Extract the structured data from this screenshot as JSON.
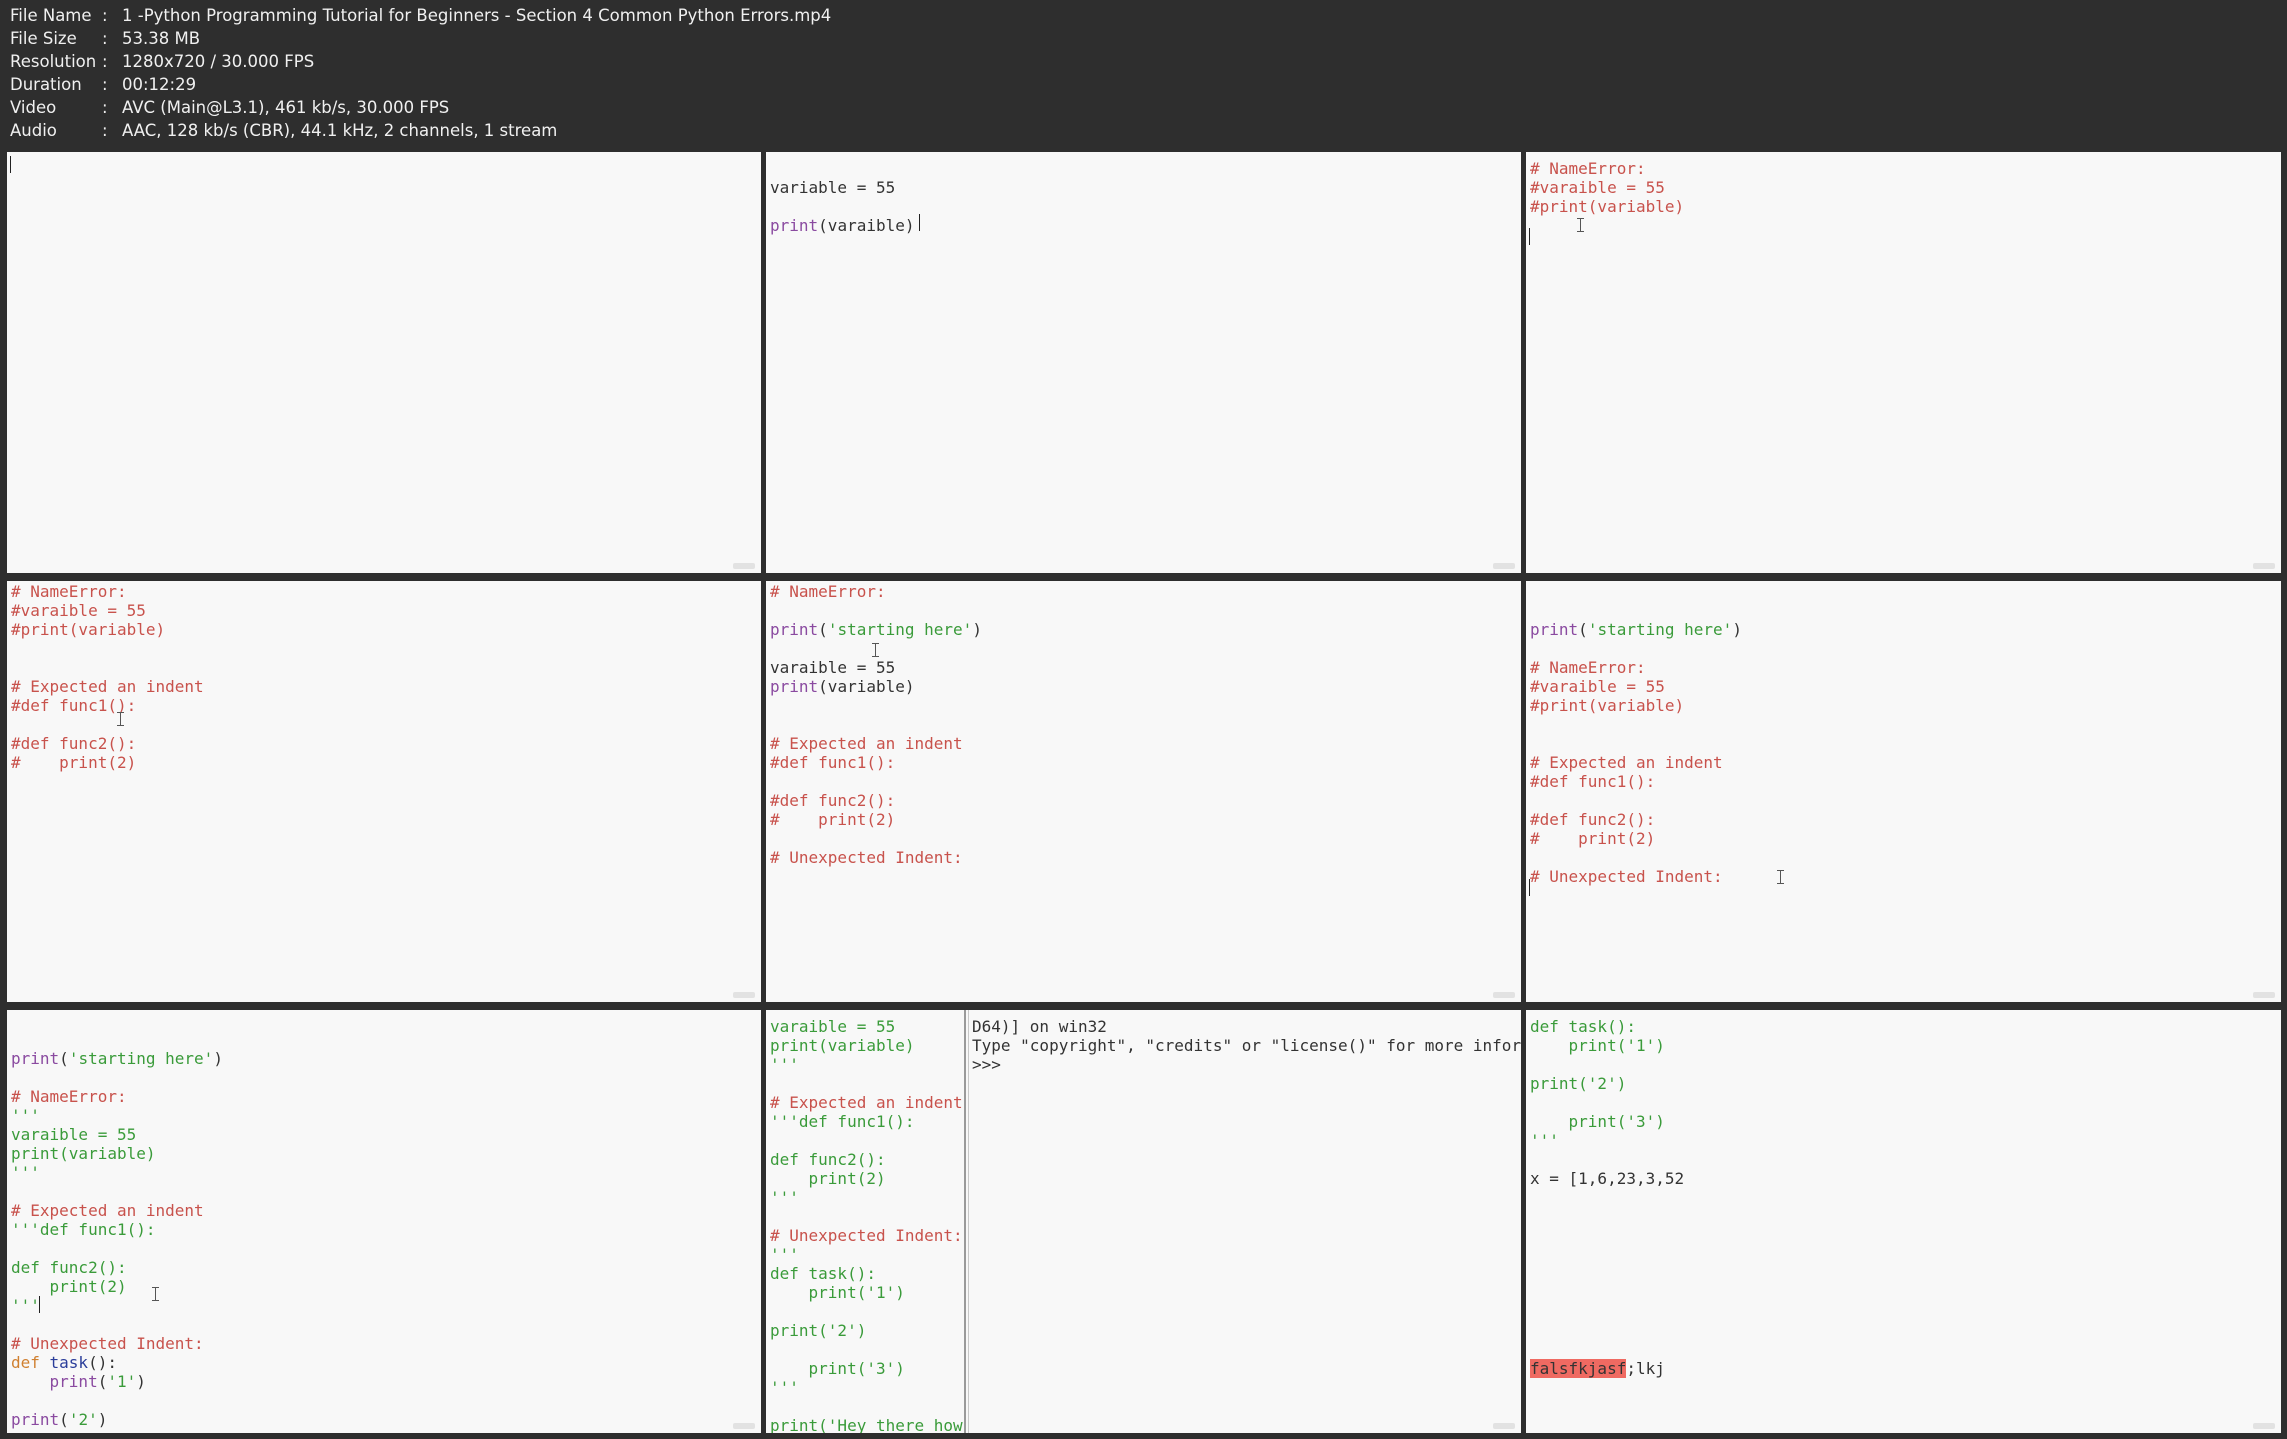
{
  "file_info": [
    {
      "key": "File Name",
      "value": "1 -Python Programming Tutorial for Beginners - Section 4 Common Python Errors.mp4"
    },
    {
      "key": "File Size",
      "value": "53.38 MB"
    },
    {
      "key": "Resolution",
      "value": "1280x720 / 30.000 FPS"
    },
    {
      "key": "Duration",
      "value": "00:12:29"
    },
    {
      "key": "Video",
      "value": "AVC (Main@L3.1), 461 kb/s, 30.000 FPS"
    },
    {
      "key": "Audio",
      "value": "AAC, 128 kb/s (CBR), 44.1 kHz, 2 channels, 1 stream"
    }
  ],
  "separator": ":",
  "colors": {
    "comment": "#c8524c",
    "string": "#3a9b3a",
    "builtin": "#8a4aa0",
    "keyword": "#d08030",
    "def": "#2b3e9a",
    "error_highlight": "#ef6a62"
  },
  "thumbnails": [
    {
      "lines": []
    },
    {
      "lines": [
        [],
        [
          {
            "t": "variable = 55",
            "c": "plain"
          }
        ],
        [],
        [
          {
            "t": "print",
            "c": "builtin"
          },
          {
            "t": "(varaible)",
            "c": "plain"
          }
        ]
      ]
    },
    {
      "lines": [
        [
          {
            "t": "# NameError:",
            "c": "comment"
          }
        ],
        [
          {
            "t": "#varaible = 55",
            "c": "comment"
          }
        ],
        [
          {
            "t": "#print(variable)",
            "c": "comment"
          }
        ]
      ]
    },
    {
      "lines": [
        [
          {
            "t": "# NameError:",
            "c": "comment"
          }
        ],
        [
          {
            "t": "#varaible = 55",
            "c": "comment"
          }
        ],
        [
          {
            "t": "#print(variable)",
            "c": "comment"
          }
        ],
        [],
        [],
        [
          {
            "t": "# Expected an indent",
            "c": "comment"
          }
        ],
        [
          {
            "t": "#def func1():",
            "c": "comment"
          }
        ],
        [],
        [
          {
            "t": "#def func2():",
            "c": "comment"
          }
        ],
        [
          {
            "t": "#    print(2)",
            "c": "comment"
          }
        ]
      ]
    },
    {
      "lines": [
        [
          {
            "t": "# NameError:",
            "c": "comment"
          }
        ],
        [],
        [
          {
            "t": "print",
            "c": "builtin"
          },
          {
            "t": "(",
            "c": "plain"
          },
          {
            "t": "'starting here'",
            "c": "string"
          },
          {
            "t": ")",
            "c": "plain"
          }
        ],
        [],
        [
          {
            "t": "varaible = 55",
            "c": "plain"
          }
        ],
        [
          {
            "t": "print",
            "c": "builtin"
          },
          {
            "t": "(variable)",
            "c": "plain"
          }
        ],
        [],
        [],
        [
          {
            "t": "# Expected an indent",
            "c": "comment"
          }
        ],
        [
          {
            "t": "#def func1():",
            "c": "comment"
          }
        ],
        [],
        [
          {
            "t": "#def func2():",
            "c": "comment"
          }
        ],
        [
          {
            "t": "#    print(2)",
            "c": "comment"
          }
        ],
        [],
        [
          {
            "t": "# Unexpected Indent:",
            "c": "comment"
          }
        ]
      ]
    },
    {
      "lines": [
        [],
        [],
        [
          {
            "t": "print",
            "c": "builtin"
          },
          {
            "t": "(",
            "c": "plain"
          },
          {
            "t": "'starting here'",
            "c": "string"
          },
          {
            "t": ")",
            "c": "plain"
          }
        ],
        [],
        [
          {
            "t": "# NameError:",
            "c": "comment"
          }
        ],
        [
          {
            "t": "#varaible = 55",
            "c": "comment"
          }
        ],
        [
          {
            "t": "#print(variable)",
            "c": "comment"
          }
        ],
        [],
        [],
        [
          {
            "t": "# Expected an indent",
            "c": "comment"
          }
        ],
        [
          {
            "t": "#def func1():",
            "c": "comment"
          }
        ],
        [],
        [
          {
            "t": "#def func2():",
            "c": "comment"
          }
        ],
        [
          {
            "t": "#    print(2)",
            "c": "comment"
          }
        ],
        [],
        [
          {
            "t": "# Unexpected Indent:",
            "c": "comment"
          }
        ]
      ]
    },
    {
      "lines": [
        [],
        [],
        [
          {
            "t": "print",
            "c": "builtin"
          },
          {
            "t": "(",
            "c": "plain"
          },
          {
            "t": "'starting here'",
            "c": "string"
          },
          {
            "t": ")",
            "c": "plain"
          }
        ],
        [],
        [
          {
            "t": "# NameError:",
            "c": "comment"
          }
        ],
        [
          {
            "t": "'''",
            "c": "string"
          }
        ],
        [
          {
            "t": "varaible = 55",
            "c": "string"
          }
        ],
        [
          {
            "t": "print(variable)",
            "c": "string"
          }
        ],
        [
          {
            "t": "'''",
            "c": "string"
          }
        ],
        [],
        [
          {
            "t": "# Expected an indent",
            "c": "comment"
          }
        ],
        [
          {
            "t": "'''def func1():",
            "c": "string"
          }
        ],
        [],
        [
          {
            "t": "def func2():",
            "c": "string"
          }
        ],
        [
          {
            "t": "    print(2)",
            "c": "string"
          }
        ],
        [
          {
            "t": "'''",
            "c": "string"
          }
        ],
        [],
        [
          {
            "t": "# Unexpected Indent:",
            "c": "comment"
          }
        ],
        [
          {
            "t": "def ",
            "c": "keyword"
          },
          {
            "t": "task",
            "c": "def"
          },
          {
            "t": "():",
            "c": "plain"
          }
        ],
        [
          {
            "t": "    print",
            "c": "builtin"
          },
          {
            "t": "(",
            "c": "plain"
          },
          {
            "t": "'1'",
            "c": "string"
          },
          {
            "t": ")",
            "c": "plain"
          }
        ],
        [],
        [
          {
            "t": "print",
            "c": "builtin"
          },
          {
            "t": "(",
            "c": "plain"
          },
          {
            "t": "'2'",
            "c": "string"
          },
          {
            "t": ")",
            "c": "plain"
          }
        ]
      ]
    },
    {
      "left_lines": [
        [
          {
            "t": "varaible = 55",
            "c": "string"
          }
        ],
        [
          {
            "t": "print(variable)",
            "c": "string"
          }
        ],
        [
          {
            "t": "'''",
            "c": "string"
          }
        ],
        [],
        [
          {
            "t": "# Expected an indent",
            "c": "comment"
          }
        ],
        [
          {
            "t": "'''def func1():",
            "c": "string"
          }
        ],
        [],
        [
          {
            "t": "def func2():",
            "c": "string"
          }
        ],
        [
          {
            "t": "    print(2)",
            "c": "string"
          }
        ],
        [
          {
            "t": "'''",
            "c": "string"
          }
        ],
        [],
        [
          {
            "t": "# Unexpected Indent:",
            "c": "comment"
          }
        ],
        [
          {
            "t": "'''",
            "c": "string"
          }
        ],
        [
          {
            "t": "def task():",
            "c": "string"
          }
        ],
        [
          {
            "t": "    print('1')",
            "c": "string"
          }
        ],
        [],
        [
          {
            "t": "print('2')",
            "c": "string"
          }
        ],
        [],
        [
          {
            "t": "    print('3')",
            "c": "string"
          }
        ],
        [
          {
            "t": "'''",
            "c": "string"
          }
        ],
        [],
        [
          {
            "t": "print('Hey there how",
            "c": "string"
          }
        ]
      ],
      "right_lines": [
        [
          {
            "t": "D64)] on win32",
            "c": "plain"
          }
        ],
        [
          {
            "t": "Type \"copyright\", \"credits\" or \"license()\" for more information.",
            "c": "plain"
          }
        ],
        [
          {
            "t": ">>>",
            "c": "plain"
          }
        ]
      ]
    },
    {
      "lines": [
        [
          {
            "t": "def task():",
            "c": "string"
          }
        ],
        [
          {
            "t": "    print('1')",
            "c": "string"
          }
        ],
        [],
        [
          {
            "t": "print('2')",
            "c": "string"
          }
        ],
        [],
        [
          {
            "t": "    print('3')",
            "c": "string"
          }
        ],
        [
          {
            "t": "'''",
            "c": "string"
          }
        ],
        [],
        [
          {
            "t": "x = [1,6,23,3,52",
            "c": "plain"
          }
        ],
        [],
        [],
        [],
        [],
        [],
        [],
        [],
        [],
        [],
        [
          {
            "t": "falsfkjasf",
            "c": "err"
          },
          {
            "t": ";lkj",
            "c": "plain"
          }
        ]
      ]
    }
  ]
}
